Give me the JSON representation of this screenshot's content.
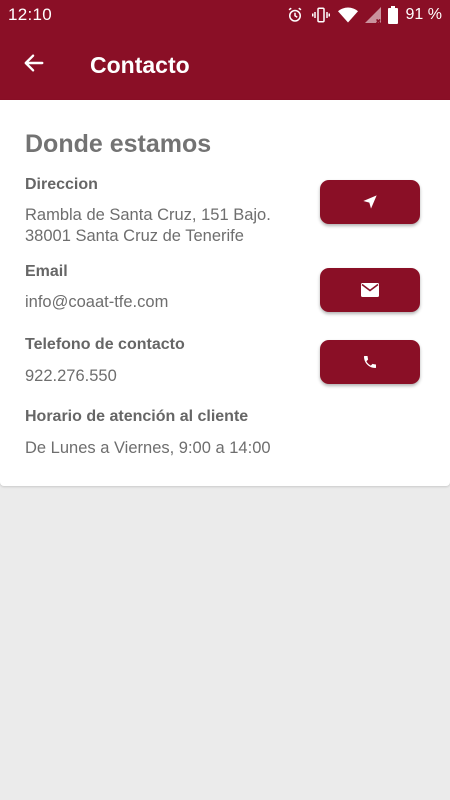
{
  "status_bar": {
    "time": "12:10",
    "battery": "91 %",
    "icons": [
      "alarm-icon",
      "vibrate-icon",
      "wifi-icon",
      "signal-icon",
      "battery-icon"
    ]
  },
  "app_bar": {
    "title": "Contacto",
    "back_icon": "arrow-back-icon"
  },
  "contact": {
    "section_title": "Donde estamos",
    "address": {
      "label": "Direccion",
      "line1": "Rambla de Santa Cruz, 151 Bajo.",
      "line2": "38001 Santa Cruz de Tenerife",
      "button_icon": "navigation-arrow-icon"
    },
    "email": {
      "label": "Email",
      "value": "info@coaat-tfe.com",
      "button_icon": "envelope-icon"
    },
    "phone": {
      "label": "Telefono de contacto",
      "value": "922.276.550",
      "button_icon": "phone-icon"
    },
    "hours": {
      "label": "Horario de atención al cliente",
      "value": "De Lunes a Viernes, 9:00 a 14:00"
    }
  },
  "colors": {
    "brand": "#8a0f26",
    "background": "#ebebeb",
    "card": "#ffffff",
    "text_muted": "#6e6e6e"
  }
}
